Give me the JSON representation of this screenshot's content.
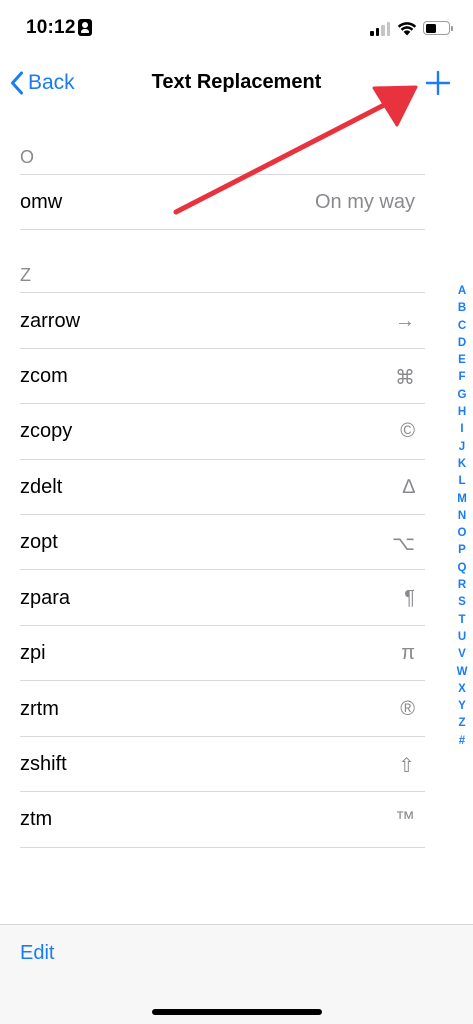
{
  "status_bar": {
    "time": "10:12",
    "icons": [
      "id-card-icon",
      "cellular-signal-icon",
      "wifi-icon",
      "battery-icon"
    ]
  },
  "nav": {
    "back_label": "Back",
    "title": "Text Replacement",
    "add_icon": "plus-icon",
    "accent_color": "#1a7cf5"
  },
  "sections": [
    {
      "header": "O",
      "items": [
        {
          "shortcut": "omw",
          "phrase": "On my way"
        }
      ]
    },
    {
      "header": "Z",
      "items": [
        {
          "shortcut": "zarrow",
          "phrase": "→"
        },
        {
          "shortcut": "zcom",
          "phrase": "⌘"
        },
        {
          "shortcut": "zcopy",
          "phrase": "©"
        },
        {
          "shortcut": "zdelt",
          "phrase": "∆"
        },
        {
          "shortcut": "zopt",
          "phrase": "⌥"
        },
        {
          "shortcut": "zpara",
          "phrase": "¶"
        },
        {
          "shortcut": "zpi",
          "phrase": "π"
        },
        {
          "shortcut": "zrtm",
          "phrase": "®"
        },
        {
          "shortcut": "zshift",
          "phrase": "⇧"
        },
        {
          "shortcut": "ztm",
          "phrase": "™"
        }
      ]
    }
  ],
  "index_letters": [
    "A",
    "B",
    "C",
    "D",
    "E",
    "F",
    "G",
    "H",
    "I",
    "J",
    "K",
    "L",
    "M",
    "N",
    "O",
    "P",
    "Q",
    "R",
    "S",
    "T",
    "U",
    "V",
    "W",
    "X",
    "Y",
    "Z",
    "#"
  ],
  "toolbar": {
    "edit_label": "Edit"
  },
  "annotation": {
    "arrow_color": "#e8333f",
    "points_to": "add-button"
  }
}
